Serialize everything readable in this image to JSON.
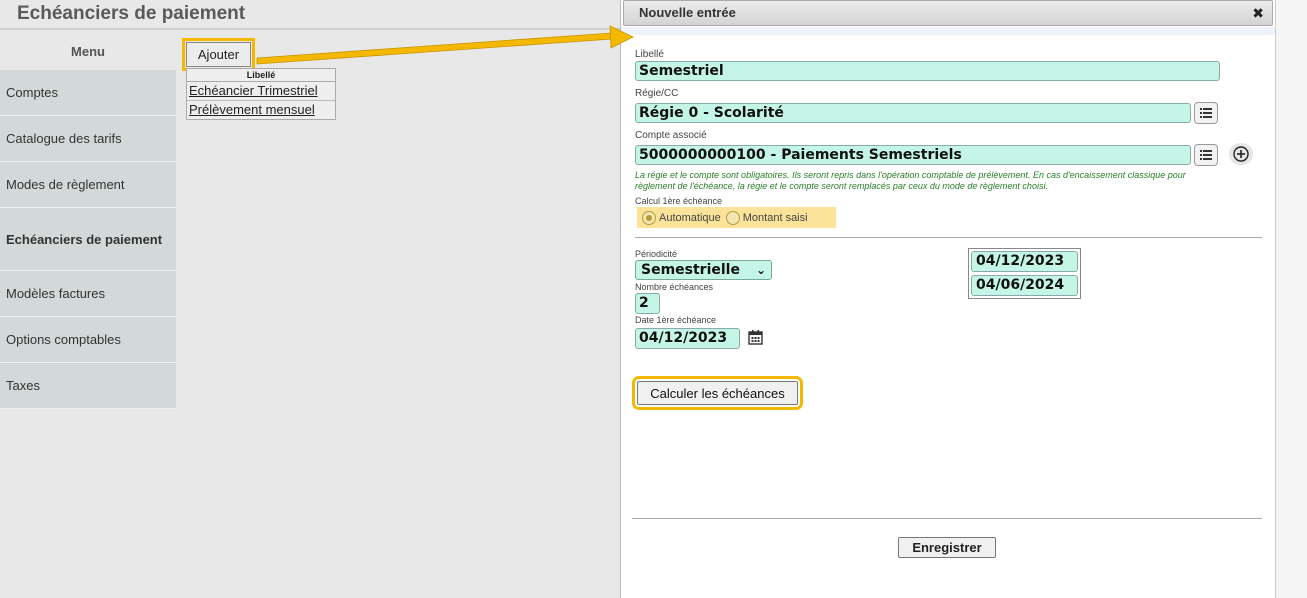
{
  "page": {
    "title": "Echéanciers de paiement"
  },
  "sidebar": {
    "menu_label": "Menu",
    "items": [
      {
        "label": "Comptes"
      },
      {
        "label": "Catalogue des tarifs"
      },
      {
        "label": "Modes de règlement"
      },
      {
        "label": "Echéanciers de paiement",
        "active": true
      },
      {
        "label": "Modèles factures"
      },
      {
        "label": "Options comptables"
      },
      {
        "label": "Taxes"
      }
    ]
  },
  "list": {
    "add_label": "Ajouter",
    "column_header": "Libellé",
    "rows": [
      "Echéancier Trimestriel",
      "Prélèvement mensuel"
    ]
  },
  "dialog": {
    "title": "Nouvelle entrée",
    "close_icon": "close-icon",
    "libelle": {
      "label": "Libellé",
      "value": "Semestriel"
    },
    "regie": {
      "label": "Régie/CC",
      "value": "Régie 0 - Scolarité"
    },
    "compte": {
      "label": "Compte associé",
      "value": "5000000000100 - Paiements Semestriels"
    },
    "note": "La régie et le compte sont obligatoires. Ils seront repris dans l'opération comptable de prélèvement. En cas d'encaissement classique pour règlement de l'échéance, la régie et le compte seront remplacés par ceux du mode de règlement choisi.",
    "calcul": {
      "label": "Calcul 1ère échéance",
      "options": [
        "Automatique",
        "Montant saisi"
      ],
      "selected": "Automatique"
    },
    "periodicite": {
      "label": "Périodicité",
      "value": "Semestrielle"
    },
    "nombre": {
      "label": "Nombre échéances",
      "value": "2"
    },
    "date_premiere": {
      "label": "Date 1ère échéance",
      "value": "04/12/2023"
    },
    "dates": [
      "04/12/2023",
      "04/06/2024"
    ],
    "calc_button": "Calculer les échéances",
    "save_button": "Enregistrer"
  },
  "highlight_color": "#f5b800",
  "field_color": "#c4f5e6"
}
